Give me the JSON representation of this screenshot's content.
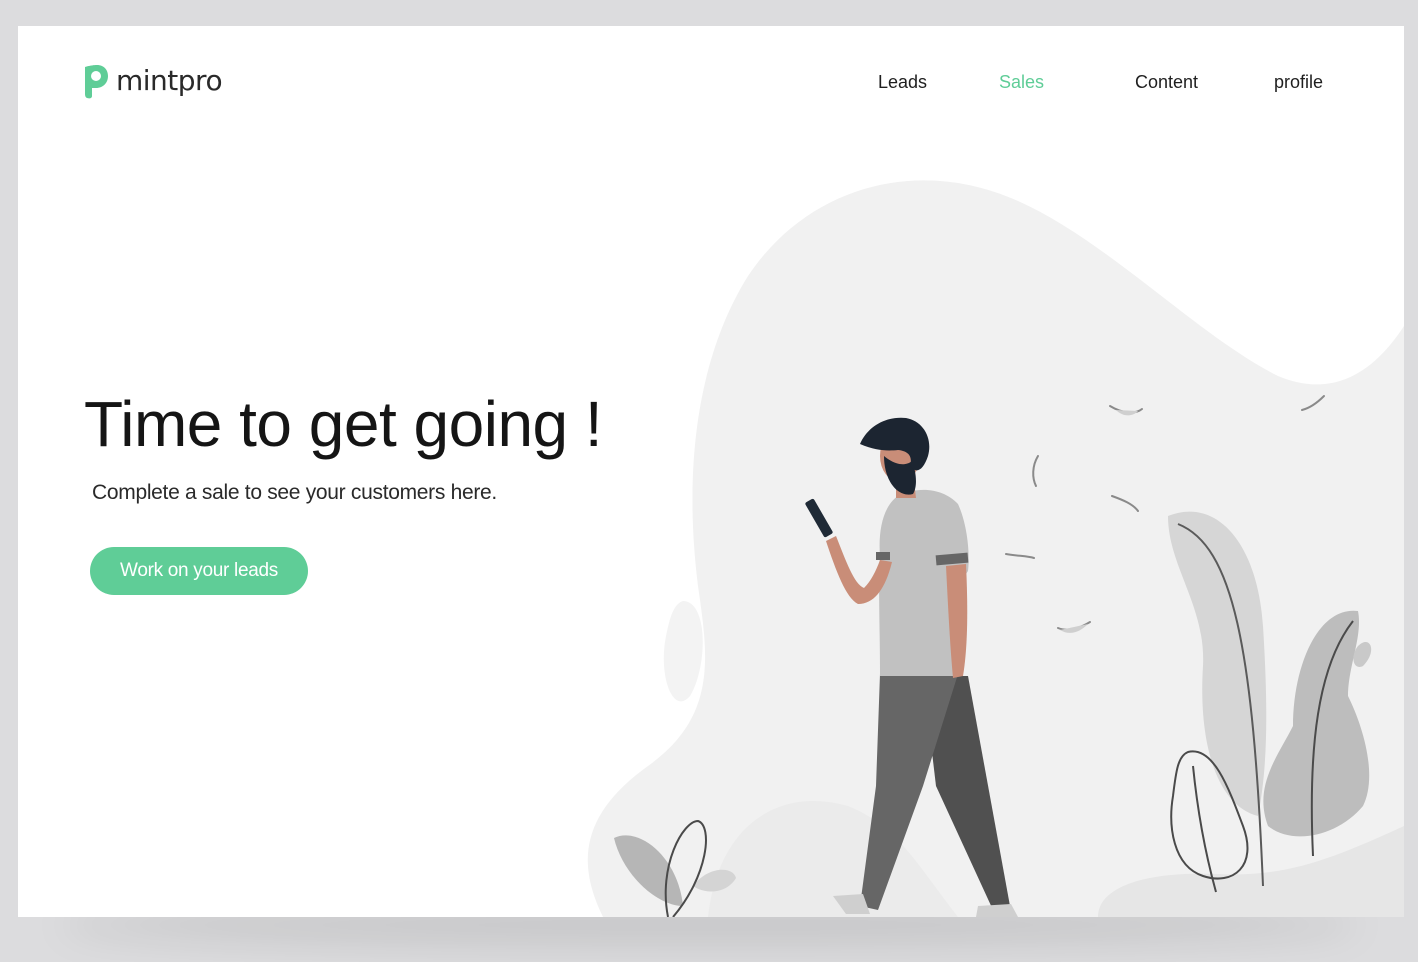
{
  "brand": {
    "name": "mintpro",
    "accent_color": "#5fcd97"
  },
  "nav": {
    "items": [
      {
        "label": "Leads",
        "active": false
      },
      {
        "label": "Sales",
        "active": true
      },
      {
        "label": "Content",
        "active": false
      },
      {
        "label": "profile",
        "active": false
      }
    ]
  },
  "hero": {
    "title": "Time to get going !",
    "subtitle": "Complete a sale to see your customers here.",
    "cta_label": "Work on your leads"
  },
  "illustration": {
    "subject": "man walking while looking at phone, leaves and plants"
  }
}
